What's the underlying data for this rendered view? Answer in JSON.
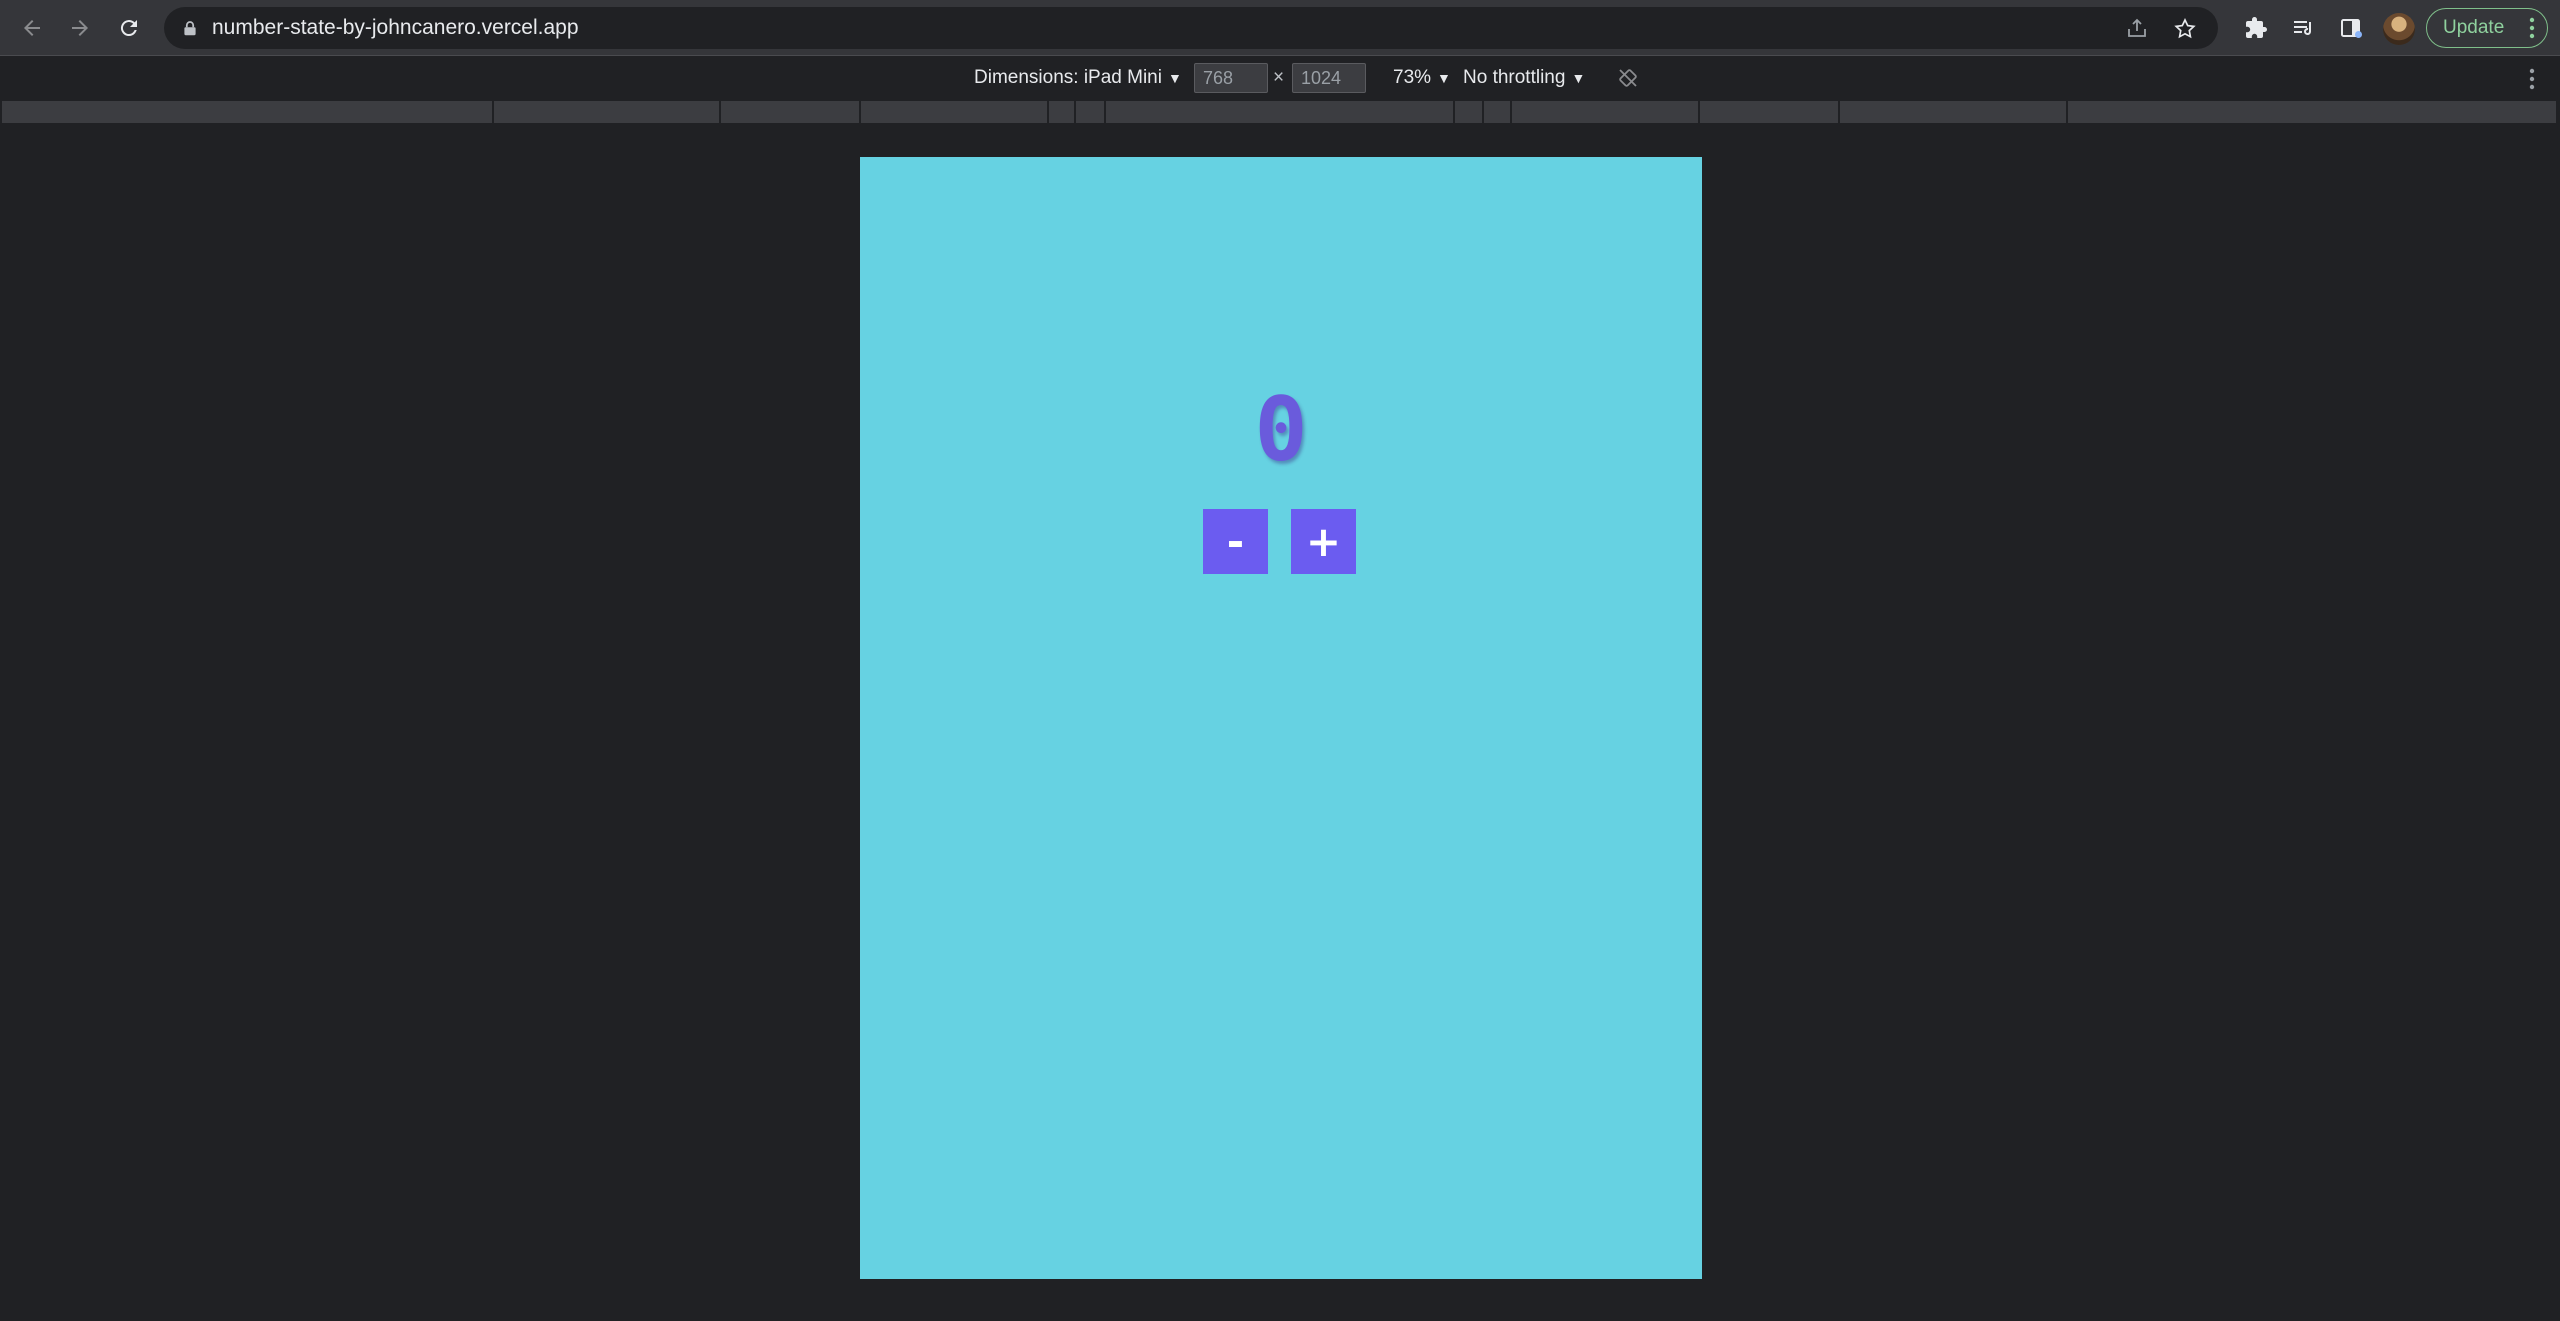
{
  "browser": {
    "url": "number-state-by-johncanero.vercel.app",
    "update_label": "Update"
  },
  "device_toolbar": {
    "dimensions_label": "Dimensions: iPad Mini",
    "width": "768",
    "times": "×",
    "height": "1024",
    "zoom": "73%",
    "throttling": "No throttling"
  },
  "app": {
    "counter_value": "0",
    "decrement_label": "-",
    "increment_label": "+",
    "background_color": "#66d2e2",
    "button_color": "#6b5cf0"
  }
}
